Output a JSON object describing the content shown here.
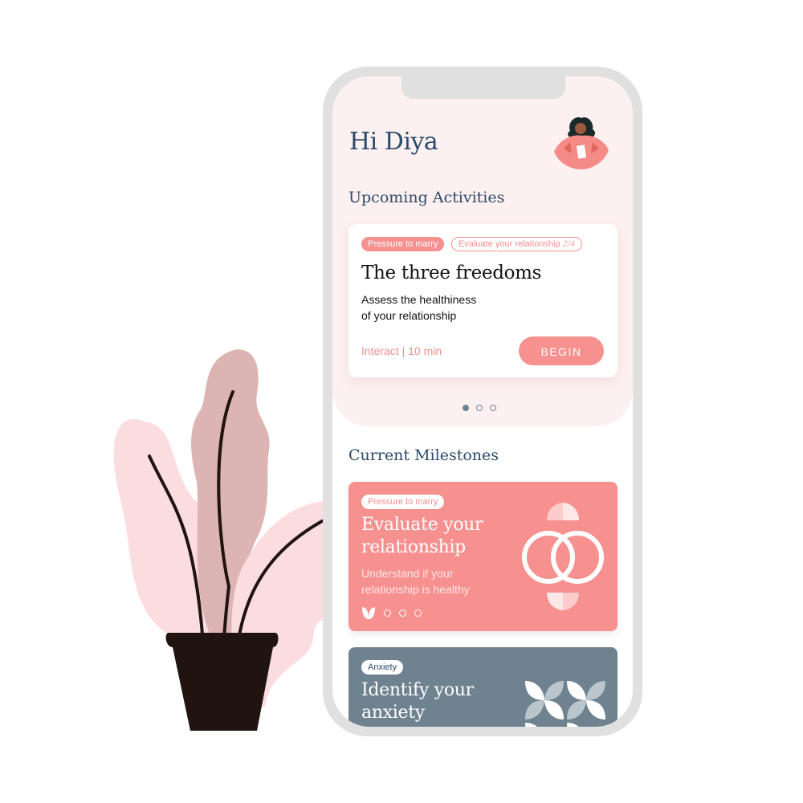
{
  "greeting": "Hi Diya",
  "avatar": {
    "icon": "woman-avatar-illustration"
  },
  "upcoming": {
    "title": "Upcoming Activities",
    "card": {
      "tag_primary": "Pressure to marry",
      "tag_secondary": "Evaluate your relationship",
      "tag_secondary_progress": "2/4",
      "title": "The three freedoms",
      "description_line1": "Assess the healthiness",
      "description_line2": "of your relationship",
      "meta": "Interact | 10 min",
      "button_label": "BEGIN"
    },
    "pagination": {
      "total": 3,
      "active": 1
    }
  },
  "milestones": {
    "title": "Current Milestones",
    "items": [
      {
        "tag": "Pressure to marry",
        "title": "Evaluate your relationship",
        "description": "Understand if your relationship is healthy",
        "progress": {
          "completed": 1,
          "total": 4
        },
        "color": "#f69190",
        "tag_color": "#f28e8d",
        "icon": "interlocking-rings-icon"
      },
      {
        "tag": "Anxiety",
        "title": "Identify your anxiety",
        "color": "#6e8290",
        "tag_color": "#2b4a6a",
        "icon": "petal-pattern-icon"
      }
    ]
  },
  "colors": {
    "accent": "#f69190",
    "heading": "#2b4a6a",
    "top_bg": "#fdf0f0",
    "slate": "#6e8290"
  }
}
